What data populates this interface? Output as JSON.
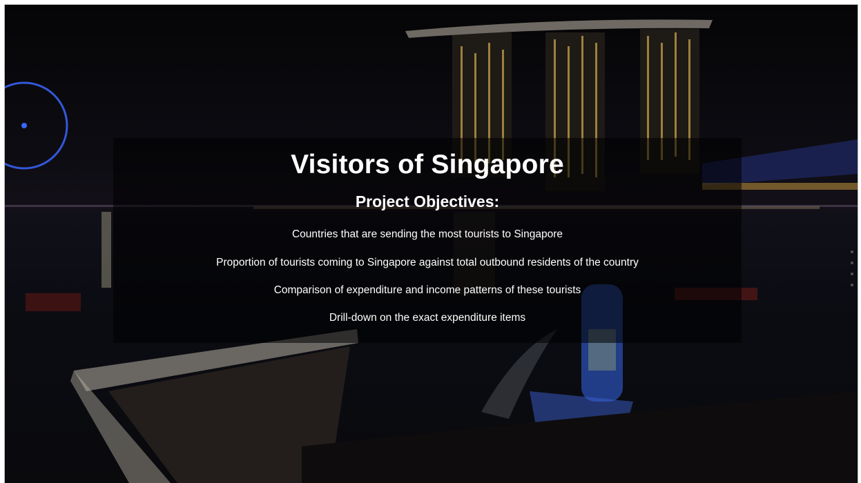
{
  "hero": {
    "title": "Visitors of Singapore",
    "subtitle": "Project Objectives:",
    "objectives": [
      "Countries that are sending the most tourists to Singapore",
      "Proportion of tourists coming to Singapore against total outbound residents of the country",
      "Comparison of expenditure and income patterns of these tourists",
      "Drill-down on the exact expenditure items"
    ]
  },
  "background": {
    "description_icon": "night-skyline-image",
    "overlay_color": "#000000",
    "text_color": "#ffffff"
  },
  "pager": {
    "dot_count": 4
  }
}
